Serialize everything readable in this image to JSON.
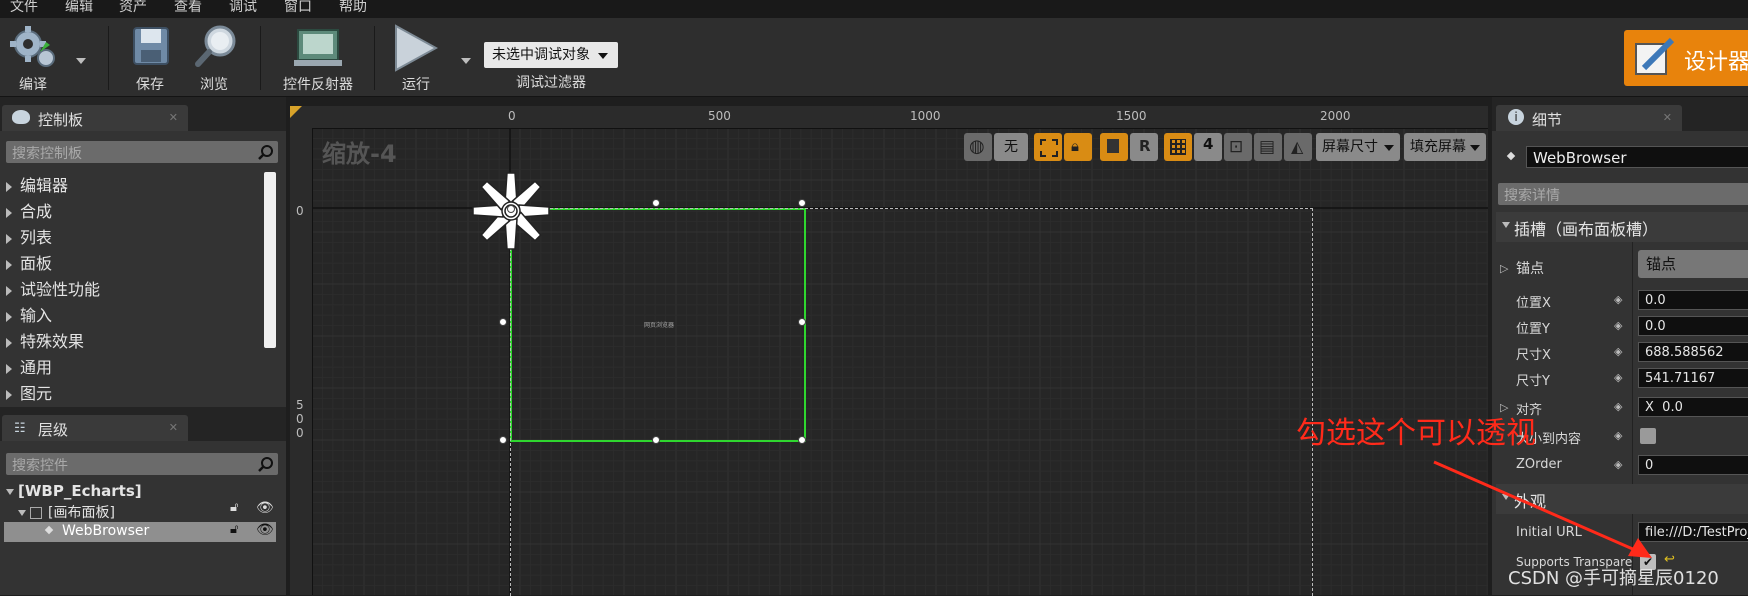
{
  "menu": [
    "文件",
    "编辑",
    "资产",
    "查看",
    "调试",
    "窗口",
    "帮助"
  ],
  "toolbar": {
    "compile": "编译",
    "save": "保存",
    "browse": "浏览",
    "widget_reflector": "控件反射器",
    "run": "运行",
    "debug_object": "未选中调试对象",
    "debug_filter": "调试过滤器",
    "designer": "设计器"
  },
  "palette": {
    "title": "控制板",
    "search_placeholder": "搜索控制板",
    "items": [
      "编辑器",
      "合成",
      "列表",
      "面板",
      "试验性功能",
      "输入",
      "特殊效果",
      "通用",
      "图元"
    ]
  },
  "hierarchy": {
    "title": "层级",
    "search_placeholder": "搜索控件",
    "root": "[WBP_Echarts]",
    "canvas": "[画布面板]",
    "widget": "WebBrowser"
  },
  "viewport": {
    "zoom": "缩放-4",
    "ruler_top": [
      "0",
      "500",
      "1000",
      "1500",
      "2000"
    ],
    "ruler_left": [
      "0",
      "5",
      "0",
      "0"
    ],
    "none_label": "无",
    "r_label": "R",
    "grid_snap": "4",
    "screen_size": "屏幕尺寸",
    "fill_screen": "填充屏幕",
    "widget_caption": "网页浏览器"
  },
  "details": {
    "title": "细节",
    "widget_name": "WebBrowser",
    "search_placeholder": "搜索详情",
    "slot_section": "插槽（画布面板槽）",
    "anchor_label": "锚点",
    "anchor_value": "锚点",
    "pos_x_label": "位置X",
    "pos_x": "0.0",
    "pos_y_label": "位置Y",
    "pos_y": "0.0",
    "size_x_label": "尺寸X",
    "size_x": "688.588562",
    "size_y_label": "尺寸Y",
    "size_y": "541.71167",
    "align_label": "对齐",
    "align_x_label": "X",
    "align_x": "0.0",
    "size_to_content": "大小到内容",
    "zorder_label": "ZOrder",
    "zorder": "0",
    "appearance_section": "外观",
    "url_label": "Initial URL",
    "url_value": "file:///D:/TestProj",
    "transparency_label": "Supports Transparen"
  },
  "annotation": {
    "text": "勾选这个可以透视",
    "color": "#ff2a1a"
  },
  "watermark": "CSDN @手可摘星辰0120",
  "colors": {
    "accent_orange": "#e8830c",
    "selection_green": "#2fd62f",
    "panel_bg": "#2e2e2e"
  }
}
